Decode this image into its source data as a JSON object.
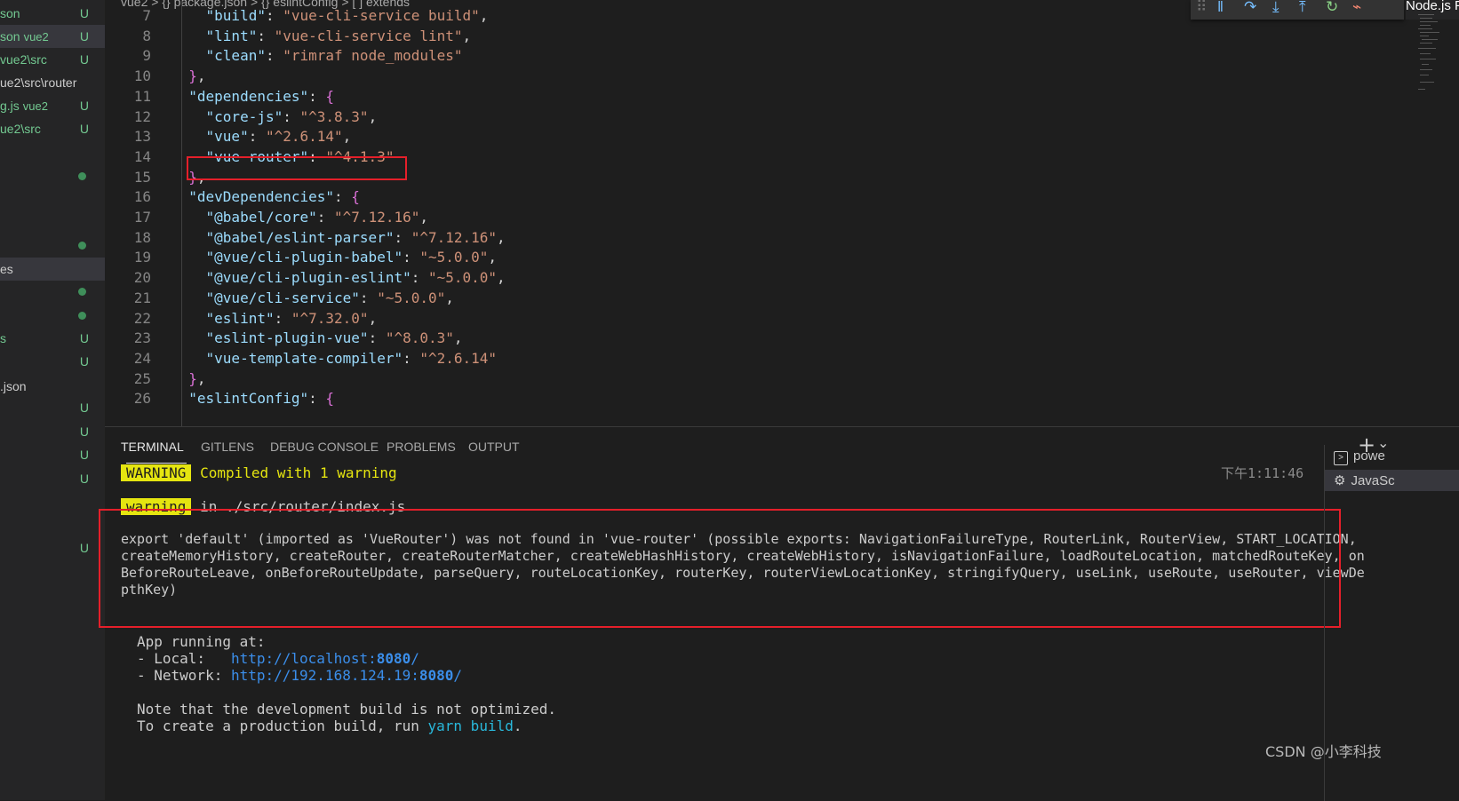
{
  "breadcrumb": {
    "items": [
      "vue2",
      "{} package.json",
      "{} eslintConfig",
      "[ ] extends"
    ],
    "separator": ">"
  },
  "sidebar": {
    "items": [
      {
        "name": "son",
        "dir": "",
        "status": "U"
      },
      {
        "name": "son",
        "dir": "vue2",
        "status": "U"
      },
      {
        "name": "vue2\\src",
        "dir": "",
        "status": "U"
      },
      {
        "name": "ue2\\src\\router",
        "dir": "",
        "status": ""
      },
      {
        "name": "g.js",
        "dir": "vue2",
        "status": "U"
      },
      {
        "name": "ue2\\src",
        "dir": "",
        "status": "U"
      },
      {
        "name": "",
        "dir": "",
        "status": "dot"
      },
      {
        "name": "",
        "dir": "",
        "status": "dot"
      },
      {
        "name": "es",
        "dir": "",
        "status": ""
      },
      {
        "name": "",
        "dir": "",
        "status": "dot"
      },
      {
        "name": "",
        "dir": "",
        "status": "dot"
      },
      {
        "name": "s",
        "dir": "",
        "status": "U"
      },
      {
        "name": "",
        "dir": "",
        "status": "U"
      },
      {
        "name": ".json",
        "dir": "",
        "status": ""
      },
      {
        "name": "",
        "dir": "",
        "status": "U"
      },
      {
        "name": "",
        "dir": "",
        "status": "U"
      },
      {
        "name": "",
        "dir": "",
        "status": "U"
      },
      {
        "name": "",
        "dir": "",
        "status": "U"
      },
      {
        "name": "",
        "dir": "",
        "status": "U"
      }
    ]
  },
  "editor": {
    "lines": [
      {
        "num": "7",
        "key": "\"build\"",
        "val": "\"vue-cli-service build\"",
        "tail": ","
      },
      {
        "num": "8",
        "key": "\"lint\"",
        "val": "\"vue-cli-service lint\"",
        "tail": ","
      },
      {
        "num": "9",
        "key": "\"clean\"",
        "val": "\"rimraf node_modules\"",
        "tail": ""
      },
      {
        "num": "10",
        "close": "}",
        "tail": ","
      },
      {
        "num": "11",
        "key": "\"dependencies\"",
        "open": "{"
      },
      {
        "num": "12",
        "key": "\"core-js\"",
        "val": "\"^3.8.3\"",
        "tail": ","
      },
      {
        "num": "13",
        "key": "\"vue\"",
        "val": "\"^2.6.14\"",
        "tail": ","
      },
      {
        "num": "14",
        "key": "\"vue-router\"",
        "val": "\"^4.1.3\"",
        "tail": ""
      },
      {
        "num": "15",
        "close": "}",
        "tail": ","
      },
      {
        "num": "16",
        "key": "\"devDependencies\"",
        "open": "{"
      },
      {
        "num": "17",
        "key": "\"@babel/core\"",
        "val": "\"^7.12.16\"",
        "tail": ","
      },
      {
        "num": "18",
        "key": "\"@babel/eslint-parser\"",
        "val": "\"^7.12.16\"",
        "tail": ","
      },
      {
        "num": "19",
        "key": "\"@vue/cli-plugin-babel\"",
        "val": "\"~5.0.0\"",
        "tail": ","
      },
      {
        "num": "20",
        "key": "\"@vue/cli-plugin-eslint\"",
        "val": "\"~5.0.0\"",
        "tail": ","
      },
      {
        "num": "21",
        "key": "\"@vue/cli-service\"",
        "val": "\"~5.0.0\"",
        "tail": ","
      },
      {
        "num": "22",
        "key": "\"eslint\"",
        "val": "\"^7.32.0\"",
        "tail": ","
      },
      {
        "num": "23",
        "key": "\"eslint-plugin-vue\"",
        "val": "\"^8.0.3\"",
        "tail": ","
      },
      {
        "num": "24",
        "key": "\"vue-template-compiler\"",
        "val": "\"^2.6.14\"",
        "tail": ""
      },
      {
        "num": "25",
        "close": "}",
        "tail": ","
      },
      {
        "num": "26",
        "key": "\"eslintConfig\"",
        "open": "{"
      }
    ]
  },
  "debug_toolbar": {
    "icons": [
      "drag-handle-icon",
      "pause-icon",
      "step-over-icon",
      "step-into-icon",
      "step-out-icon",
      "restart-icon",
      "disconnect-icon"
    ]
  },
  "debug_session": "Node.js Pro",
  "panel": {
    "tabs": [
      "TERMINAL",
      "GITLENS",
      "DEBUG CONSOLE",
      "PROBLEMS",
      "OUTPUT"
    ],
    "active_tab": "TERMINAL",
    "new_terminal": "+",
    "dropdown": "⌄"
  },
  "terminal": {
    "warning_badge": "WARNING",
    "compiled_msg": "Compiled with 1 warning",
    "timestamp": "下午1:11:46",
    "warning_badge2": "warning",
    "warning_loc": "in ./src/router/index.js",
    "error_lines": [
      "export 'default' (imported as 'VueRouter') was not found in 'vue-router' (possible exports: NavigationFailureType, RouterLink, RouterView, START_LOCATION,",
      "createMemoryHistory, createRouter, createRouterMatcher, createWebHashHistory, createWebHistory, isNavigationFailure, loadRouteLocation, matchedRouteKey, on",
      "BeforeRouteLeave, onBeforeRouteUpdate, parseQuery, routeLocationKey, routerKey, routerViewLocationKey, stringifyQuery, useLink, useRoute, useRouter, viewDe",
      "pthKey)"
    ],
    "app_running": "App running at:",
    "local_label": "- Local:   ",
    "local_url": "http://localhost:",
    "local_port": "8080",
    "local_slash": "/",
    "network_label": "- Network: ",
    "network_url": "http://192.168.124.19:",
    "network_port": "8080",
    "network_slash": "/",
    "note1": "Note that the development build is not optimized.",
    "note2_prefix": "To create a production build, run ",
    "note2_cmd": "yarn build",
    "note2_suffix": "."
  },
  "terminal_list": [
    {
      "icon": "terminal-icon",
      "label": "powe"
    },
    {
      "icon": "debug-icon",
      "label": "JavaSc"
    }
  ],
  "watermark": "CSDN @小李科技",
  "colors": {
    "highlight_box": "#e51f2a",
    "warning_badge": "#e5e510",
    "untracked": "#73c991"
  }
}
